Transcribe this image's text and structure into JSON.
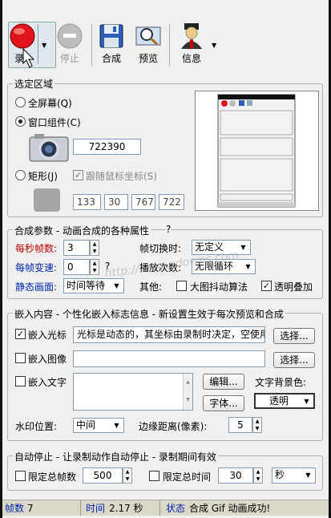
{
  "toolbar": {
    "record": "录",
    "stop": "停止",
    "compose": "合成",
    "preview": "预览",
    "info": "信息"
  },
  "area": {
    "title": "选定区域",
    "fullscreen": "全屏幕(Q)",
    "window": "窗口组件(C)",
    "handle": "722390",
    "rect": "矩形(J)",
    "follow": "跟随鼠标坐标(S)",
    "coords": [
      "133",
      "30",
      "767",
      "722"
    ]
  },
  "params": {
    "title": "合成参数 - 动画合成的各种属性",
    "help": "?",
    "fps_label": "每秒帧数:",
    "fps": "3",
    "transition_label": "帧切换时:",
    "transition": "无定义",
    "speed_label": "每帧变速:",
    "speed": "0",
    "speed_help": "?",
    "loop_label": "播放次数:",
    "loop": "无限循环",
    "static_label": "静态画面:",
    "static": "时间等待",
    "other_label": "其他:",
    "antishake": "大图抖动算法",
    "transparent": "透明叠加"
  },
  "embed": {
    "title": "嵌入内容 - 个性化嵌入标志信息 - 新设置生效于每次预览和合成",
    "cursor": "嵌入光标",
    "cursor_desc": "光标是动态的，其坐标由录制时决定，空使用",
    "choose1": "选择...",
    "image": "嵌入图像",
    "image_path": "",
    "choose2": "选择...",
    "text": "嵌入文字",
    "edit": "编辑...",
    "font": "字体...",
    "bg_label": "文字背景色:",
    "bg_value": "透明",
    "pos_label": "水印位置:",
    "pos": "中间",
    "margin_label": "边缘距离(像素):",
    "margin": "5"
  },
  "autostop": {
    "title": "自动停止 - 让录制动作自动停止 - 录制期间有效",
    "limit_frames": "限定总帧数",
    "frames": "500",
    "limit_time": "限定总时间",
    "time": "30",
    "unit": "秒"
  },
  "watermark": "http://www.xdowns.com",
  "status": {
    "frames_label": "帧数",
    "frames": "7",
    "time_label": "时间",
    "time": "2.17 秒",
    "state_label": "状态",
    "state": "合成 Gif 动画成功!"
  },
  "colors": {
    "accent_red": "#c00000",
    "accent_blue": "#0026b0",
    "record": "#e0141a"
  }
}
